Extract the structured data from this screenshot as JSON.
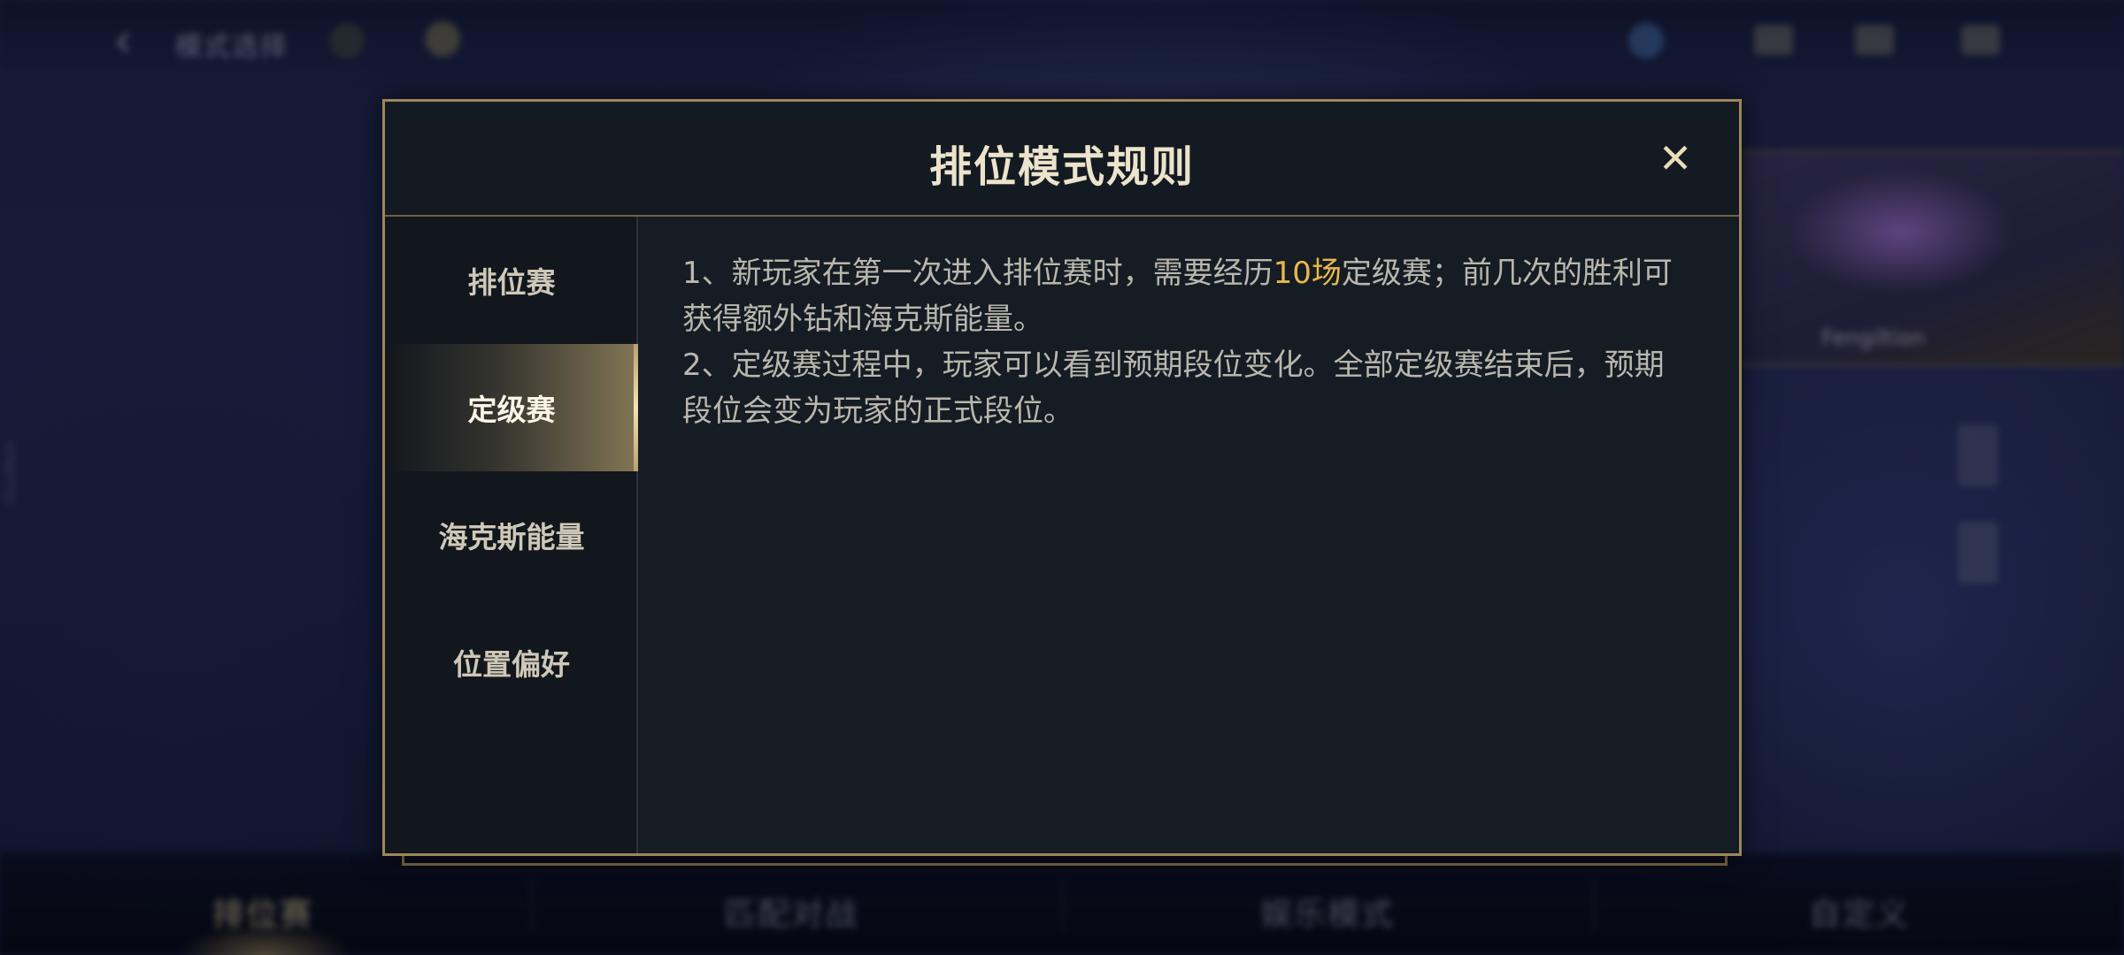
{
  "background": {
    "header_title": "模式选择",
    "hero_name": "Fengiltion",
    "watermark": "47647752",
    "bottom_tabs": [
      "排位赛",
      "匹配对战",
      "娱乐模式",
      "自定义"
    ]
  },
  "modal": {
    "title": "排位模式规则",
    "close_icon": "close-icon",
    "tabs": [
      {
        "label": "排位赛",
        "active": false
      },
      {
        "label": "定级赛",
        "active": true
      },
      {
        "label": "海克斯能量",
        "active": false
      },
      {
        "label": "位置偏好",
        "active": false
      }
    ],
    "content": {
      "rule1_prefix": "1、新玩家在第一次进入排位赛时，需要经历",
      "rule1_highlight": "10场",
      "rule1_suffix": "定级赛；前几次的胜利可获得额外钻和海克斯能量。",
      "rule2": "2、定级赛过程中，玩家可以看到预期段位变化。全部定级赛结束后，预期段位会变为玩家的正式段位。"
    }
  },
  "colors": {
    "accent_gold": "#9d875a",
    "highlight": "#e9b84b",
    "panel_bg": "#161c24"
  }
}
